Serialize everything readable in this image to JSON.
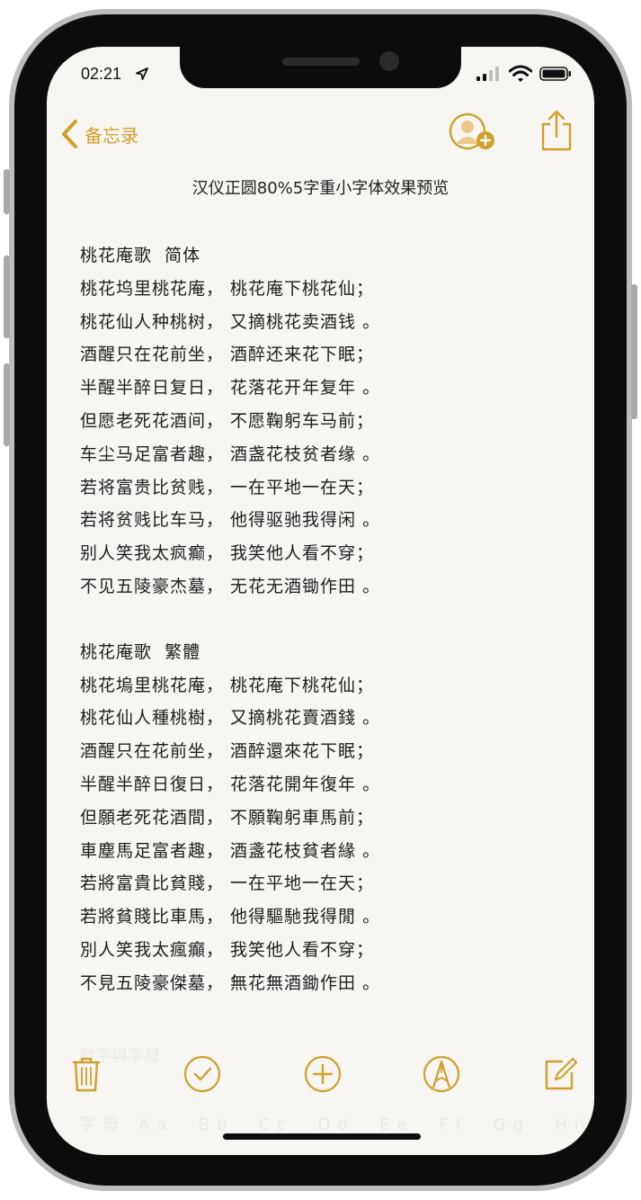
{
  "status_bar": {
    "time": "02:21"
  },
  "nav": {
    "back_label": "备忘录"
  },
  "note": {
    "title": "汉仪正圆80%5字重小字体效果预览",
    "simplified": {
      "heading": "桃花庵歌  简体",
      "lines": [
        "桃花坞里桃花庵， 桃花庵下桃花仙；",
        "桃花仙人种桃树， 又摘桃花卖酒钱 。",
        "酒醒只在花前坐， 酒醉还来花下眠；",
        "半醒半醉日复日， 花落花开年复年 。",
        "但愿老死花酒间， 不愿鞠躬车马前；",
        "车尘马足富者趣， 酒盏花枝贫者缘 。",
        "若将富贵比贫贱， 一在平地一在天；",
        "若将贫贱比车马， 他得驱驰我得闲 。",
        "别人笑我太疯癫， 我笑他人看不穿；",
        "不见五陵豪杰墓， 无花无酒锄作田 。"
      ]
    },
    "traditional": {
      "heading": "桃花庵歌  繁體",
      "lines": [
        "桃花塢里桃花庵， 桃花庵下桃花仙；",
        "桃花仙人種桃樹， 又摘桃花賣酒錢 。",
        "酒醒只在花前坐， 酒醉還來花下眠；",
        "半醒半醉日復日， 花落花開年復年 。",
        "但願老死花酒間， 不願鞠躬車馬前；",
        "車塵馬足富者趣， 酒盞花枝貧者緣 。",
        "若將富貴比貧賤， 一在平地一在天；",
        "若將貧賤比車馬， 他得驅馳我得閒 。",
        "別人笑我太瘋癲， 我笑他人看不穿；",
        "不見五陵豪傑墓， 無花無酒鋤作田 。"
      ]
    },
    "faded_lines": [
      "數字與字母",
      "字母 Aa  Bb  Cc  Dd  Ee  Ff  Gg  Hh  Ii"
    ]
  },
  "icons": {
    "location": "location-arrow-icon",
    "signal": "cellular-signal-icon",
    "wifi": "wifi-icon",
    "battery": "battery-icon",
    "back": "chevron-left-icon",
    "add_person": "add-person-icon",
    "share": "share-icon",
    "trash": "trash-icon",
    "checklist": "checklist-icon",
    "add": "plus-circle-icon",
    "markup": "markup-pen-icon",
    "compose": "compose-icon"
  },
  "colors": {
    "accent": "#d1a02a",
    "paper": "#f7f6f3",
    "text": "#1e1e1e",
    "frame": "#0c0c0c"
  }
}
